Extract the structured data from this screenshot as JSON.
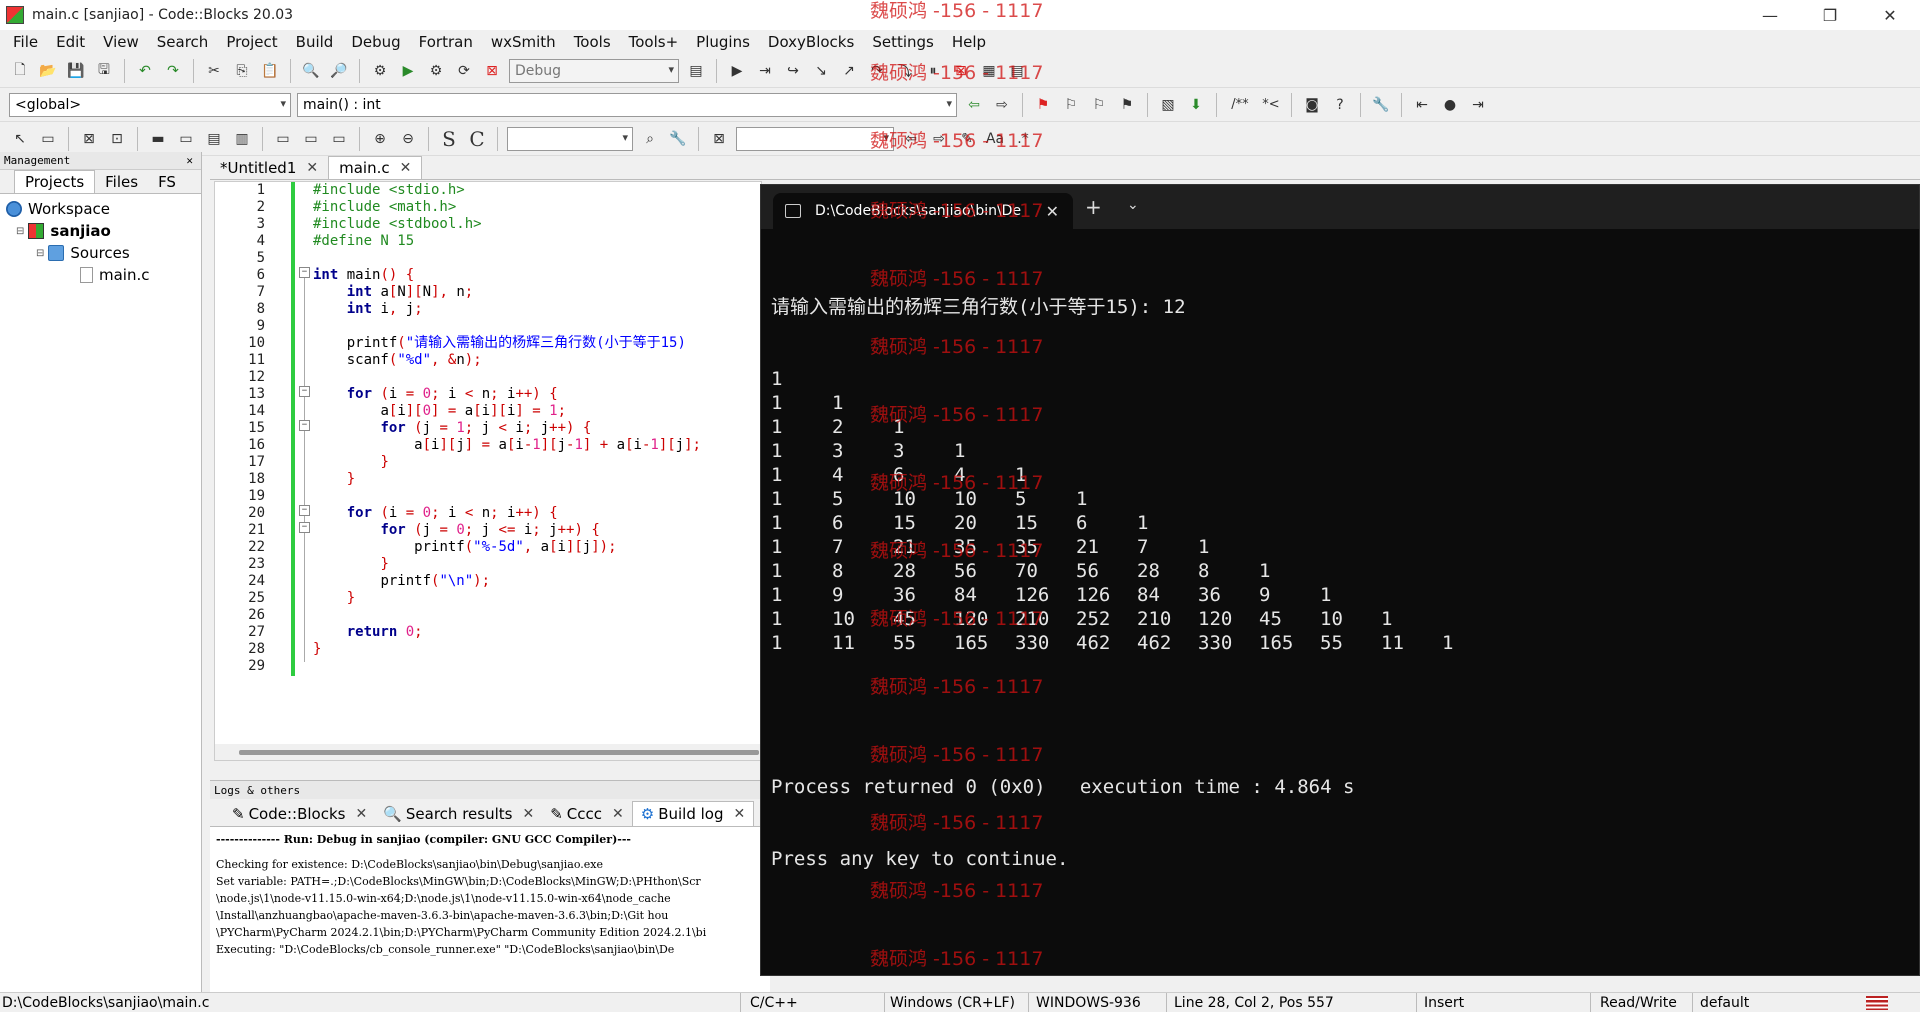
{
  "window": {
    "title": "main.c [sanjiao] - Code::Blocks 20.03",
    "minimize": "—",
    "maximize": "❐",
    "close": "✕"
  },
  "menu": [
    "File",
    "Edit",
    "View",
    "Search",
    "Project",
    "Build",
    "Debug",
    "Fortran",
    "wxSmith",
    "Tools",
    "Tools+",
    "Plugins",
    "DoxyBlocks",
    "Settings",
    "Help"
  ],
  "toolbar": {
    "build_target": "Debug",
    "scope": "<global>",
    "function": "main() : int",
    "doxy_comment1": "/**",
    "doxy_comment2": "*<"
  },
  "management": {
    "header": "Management",
    "close": "✕",
    "tabs": [
      "Projects",
      "Files",
      "FS"
    ],
    "tree": {
      "workspace": "Workspace",
      "project": "sanjiao",
      "folder": "Sources",
      "file": "main.c"
    }
  },
  "editor": {
    "tabs": [
      {
        "label": "*Untitled1",
        "close": "✕"
      },
      {
        "label": "main.c",
        "close": "✕"
      }
    ],
    "line_numbers": [
      "1",
      "2",
      "3",
      "4",
      "5",
      "6",
      "7",
      "8",
      "9",
      "10",
      "11",
      "12",
      "13",
      "14",
      "15",
      "16",
      "17",
      "18",
      "19",
      "20",
      "21",
      "22",
      "23",
      "24",
      "25",
      "26",
      "27",
      "28",
      "29"
    ],
    "lines": [
      "#include <stdio.h>",
      "#include <math.h>",
      "#include <stdbool.h>",
      "#define N 15",
      "",
      "int main() {",
      "    int a[N][N], n;",
      "    int i, j;",
      "",
      "    printf(\"请输入需输出的杨辉三角行数(小于等于15)",
      "    scanf(\"%d\", &n);",
      "",
      "    for (i = 0; i < n; i++) {",
      "        a[i][0] = a[i][i] = 1;",
      "        for (j = 1; j < i; j++) {",
      "            a[i][j] = a[i-1][j-1] + a[i-1][j];",
      "        }",
      "    }",
      "",
      "    for (i = 0; i < n; i++) {",
      "        for (j = 0; j <= i; j++) {",
      "            printf(\"%-5d\", a[i][j]);",
      "        }",
      "        printf(\"\\n\");",
      "    }",
      "",
      "    return 0;",
      "}",
      ""
    ]
  },
  "logs": {
    "header": "Logs & others",
    "tabs": [
      {
        "label": "Code::Blocks",
        "close": "✕"
      },
      {
        "label": "Search results",
        "close": "✕"
      },
      {
        "label": "Cccc",
        "close": "✕"
      },
      {
        "label": "Build log",
        "close": "✕"
      }
    ],
    "lines": [
      "-------------- Run: Debug in sanjiao (compiler: GNU GCC Compiler)---",
      "",
      "Checking for existence: D:\\CodeBlocks\\sanjiao\\bin\\Debug\\sanjiao.exe",
      "Set variable: PATH=.;D:\\CodeBlocks\\MinGW\\bin;D:\\CodeBlocks\\MinGW;D:\\PHthon\\Scr",
      "\\node.js\\1\\node-v11.15.0-win-x64;D:\\node.js\\1\\node-v11.15.0-win-x64\\node_cache",
      "\\Install\\anzhuangbao\\apache-maven-3.6.3-bin\\apache-maven-3.6.3\\bin;D:\\Git hou",
      "\\PYCharm\\PyCharm 2024.2.1\\bin;D:\\PYCharm\\PyCharm Community Edition 2024.2.1\\bi",
      "Executing: \"D:\\CodeBlocks/cb_console_runner.exe\" \"D:\\CodeBlocks\\sanjiao\\bin\\De"
    ]
  },
  "terminal": {
    "tab_title": "D:\\CodeBlocks\\sanjiao\\bin\\De",
    "close": "✕",
    "plus": "+",
    "dropdown": "⌄",
    "prompt": "请输入需输出的杨辉三角行数(小于等于15): 12",
    "rows": [
      [
        "1"
      ],
      [
        "1",
        "1"
      ],
      [
        "1",
        "2",
        "1"
      ],
      [
        "1",
        "3",
        "3",
        "1"
      ],
      [
        "1",
        "4",
        "6",
        "4",
        "1"
      ],
      [
        "1",
        "5",
        "10",
        "10",
        "5",
        "1"
      ],
      [
        "1",
        "6",
        "15",
        "20",
        "15",
        "6",
        "1"
      ],
      [
        "1",
        "7",
        "21",
        "35",
        "35",
        "21",
        "7",
        "1"
      ],
      [
        "1",
        "8",
        "28",
        "56",
        "70",
        "56",
        "28",
        "8",
        "1"
      ],
      [
        "1",
        "9",
        "36",
        "84",
        "126",
        "126",
        "84",
        "36",
        "9",
        "1"
      ],
      [
        "1",
        "10",
        "45",
        "120",
        "210",
        "252",
        "210",
        "120",
        "45",
        "10",
        "1"
      ],
      [
        "1",
        "11",
        "55",
        "165",
        "330",
        "462",
        "462",
        "330",
        "165",
        "55",
        "11",
        "1"
      ]
    ],
    "footer1": "Process returned 0 (0x0)   execution time : 4.864 s",
    "footer2": "Press any key to continue."
  },
  "watermark": "魏硕鸿 -156 - 1117",
  "statusbar": {
    "path": "D:\\CodeBlocks\\sanjiao\\main.c",
    "language": "C/C++",
    "eol": "Windows (CR+LF)",
    "encoding": "WINDOWS-936",
    "position": "Line 28, Col 2, Pos 557",
    "mode": "Insert",
    "access": "Read/Write",
    "profile": "default"
  }
}
